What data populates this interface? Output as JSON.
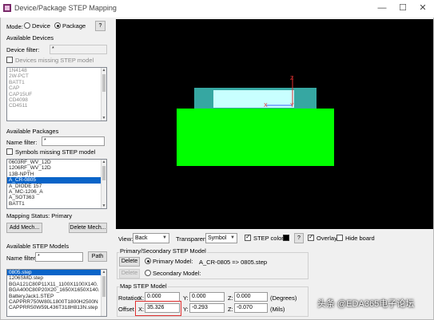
{
  "window": {
    "title": "Device/Package STEP Mapping",
    "help_label": "?"
  },
  "mode": {
    "label": "Mode:",
    "device_label": "Device",
    "package_label": "Package",
    "selected": "Package"
  },
  "devices": {
    "header": "Available Devices",
    "filter_label": "Device filter:",
    "filter_value": "*",
    "missing_label": "Devices missing STEP model",
    "missing_checked": false,
    "items": [
      "1N4148",
      "2W-PCT",
      "BATT1",
      "CAP",
      "CAP15UF",
      "CD4098",
      "CD4511"
    ]
  },
  "packages": {
    "header": "Available Packages",
    "filter_label": "Name filter:",
    "filter_value": "*",
    "missing_label": "Symbols missing STEP model",
    "missing_checked": false,
    "items": [
      "0603RF_WV_12D",
      "1206RF_WV_12D",
      "13B-NPTH",
      "A_CR-0805",
      "A_DIODE 157",
      "A_MC-1206_A",
      "A_SOT363",
      "BATT1"
    ],
    "selected_index": 3,
    "status": "Mapping Status: Primary",
    "add_label": "Add Mech...",
    "delete_label": "Delete Mech..."
  },
  "models": {
    "header": "Available STEP Models",
    "filter_label": "Name filter:",
    "filter_value": "*",
    "path_label": "Path",
    "items": [
      "0805.step",
      "1206SMD.step",
      "BGA121C80P11X11_1100X1100X140.",
      "BGA400C80P20X20_1650X1650X140.",
      "BatteryJack1.STEP",
      "CAPPRR750W80L1800T1800H2500N",
      "CAPPRR50W59L436T318H813N.step"
    ],
    "selected_index": 0
  },
  "view": {
    "view_label": "View:",
    "view_value": "Back",
    "transparent_label": "Transparent:",
    "transparent_value": "Symbol",
    "step_color_label": "STEP color",
    "step_color_checked": true,
    "step_color": "#000000",
    "help_label": "?",
    "overlay_label": "Overlay",
    "overlay_checked": true,
    "hide_board_label": "Hide board",
    "hide_board_checked": false
  },
  "primary_secondary": {
    "header": "Primary/Secondary STEP Model",
    "delete_label": "Delete",
    "primary_label": "Primary Model:",
    "primary_value": "A_CR-0805 => 0805.step",
    "delete2_label": "Delete",
    "secondary_label": "Secondary Model:",
    "selected": "Primary"
  },
  "map": {
    "header": "Map STEP Model",
    "rotation_label": "Rotation",
    "offset_label": "Offset",
    "x_label": "X:",
    "y_label": "Y:",
    "z_label": "Z:",
    "rot_x": "0.000",
    "rot_y": "0.000",
    "rot_z": "0.000",
    "off_x": "35.326",
    "off_y": "-0.293",
    "off_z": "-0.070",
    "degrees_label": "(Degrees)",
    "units_label": "(Mils)"
  },
  "viewport_axes": {
    "z_label": "Z",
    "x_label": "X",
    "y_label": "Y"
  },
  "watermark": "头条 @EDA365电子论坛",
  "colors": {
    "viewport_bg": "#000000",
    "board": "#00ff00",
    "component_body": "#36a7a2",
    "component_top": "#c8ffff",
    "selection": "#0a64c8",
    "highlight": "#e03030"
  }
}
